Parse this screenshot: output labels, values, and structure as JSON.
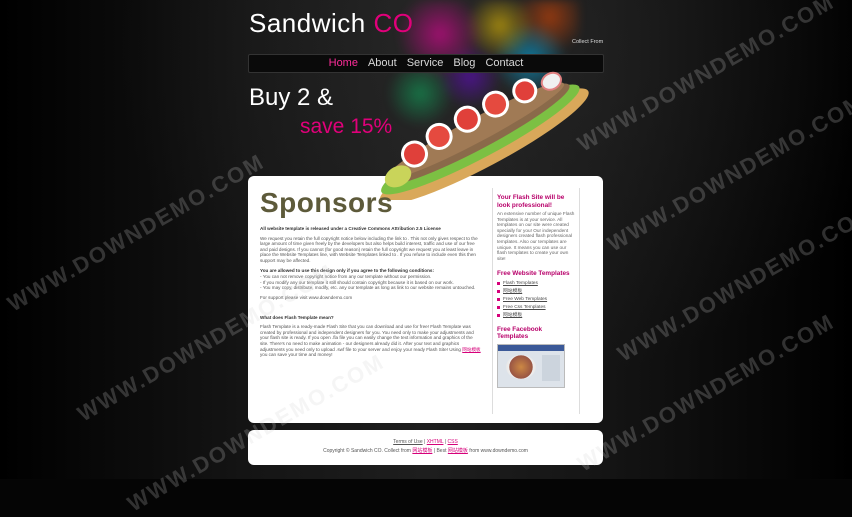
{
  "header": {
    "logo_main": "Sandwich ",
    "logo_accent": "CO",
    "collect_text": "Collect From"
  },
  "nav": {
    "items": [
      "Home",
      "About",
      "Service",
      "Blog",
      "Contact"
    ],
    "active_index": 0
  },
  "promo": {
    "line1": "Buy 2 &",
    "line2": "save 15%"
  },
  "main": {
    "title": "Sponsors",
    "license_heading": "All website template is released under a Creative Commons Attribution 2.5 License",
    "license_body": "We request you retain the full copyright notice below including the link to . This not only gives respect to the large amount of time given freely by the developers but also helps build interest, traffic and use of our free and paid designs. If you cannot (for good reason) retain the full copyright we request you at least leave in place the Website Templates line, with Website Templates linked to . If you refuse to include even this then support may be affected.",
    "allowed_heading": "You are allowed to use this design only if you agree to the following conditions:",
    "cond1": "- You can not remove copyright notice from any our template without our permission.",
    "cond2": "- If you modify any our template it still should contain copyright because it is based on our work.",
    "cond3": "- You may copy, distribute, modify, etc. any our template as long as link to our website remains untouched.",
    "support": "For support please visit www.downdemo.com",
    "flash_heading": "What does Flash Template mean?",
    "flash_body": "Flash Template is a ready-made Flash Site that you can download and use for free! Flash Template was created by professional and independent designers for you. You need only to make your adjustments and your flash site is ready. If you open .fla file you can easily change the text information and graphics of the site. There's no need to make animation - our designers already did it. After your text and graphics adjustments you need only to upload .swf file to your server and enjoy your ready Flash Site! Using",
    "flash_link": "网站模板",
    "flash_tail": " you can save your time and money!"
  },
  "sidebar": {
    "promo_title": "Your Flash Site will be look professional!",
    "promo_text": "An extensive number of unique Flash Templates is at your service. All templates on our site were created specially for you! Our independent designers created flash professional templates. Also our templates are unique. It means you can use our flash templates to create your own site!",
    "free_title": "Free Website Templates",
    "links": [
      "Flash Templates",
      "网站模板",
      "Free Web Templates",
      "Free Css Templates",
      "网站模板"
    ],
    "facebook_title": "Free Facebook Templates"
  },
  "footer": {
    "terms": "Terms of Use",
    "sep1": " | ",
    "xhtml": "XHTML",
    "sep2": " | ",
    "css": "CSS",
    "copyright_pre": "Copyright © Sandwich CO. Collect from ",
    "copyright_link": "网站模板",
    "copyright_mid": " | Best ",
    "copyright_link2": "网站模板",
    "copyright_post": " from www.downdemo.com"
  },
  "watermark": "WWW.DOWNDEMO.COM",
  "colors": {
    "accent": "#e0007a",
    "nav_active": "#ff2d9b",
    "sponsors_title": "#5d5a3a"
  }
}
